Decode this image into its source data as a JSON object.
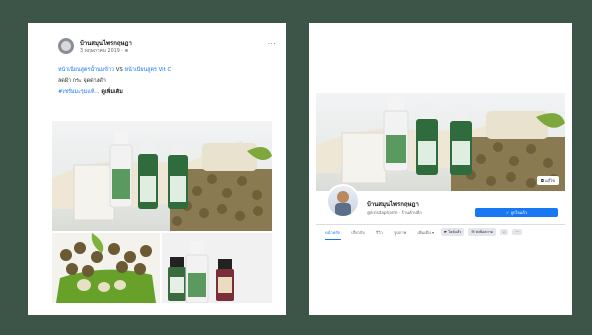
{
  "post": {
    "page_name": "บ้านสมุนไพรกฤษฎา",
    "date": "3 พฤษภาคม 2019 · ⊕",
    "more": "···",
    "line1_link_a": "หน้าเนียนสูตรน้ำนมข้าว",
    "line1_vs": " VS ",
    "line1_link_b": "หน้าเนียนสูตร Vit C",
    "line2": "ลดฝ้า กระ จุดด่างดำ",
    "line3_link": "#เซรั่มมะรุมแท้...",
    "line3_bold": " ดูเพิ่มเติม"
  },
  "page": {
    "name": "บ้านสมุนไพรกฤษฎา",
    "handle": "@krisdapharm · ร้านค้าปลีก",
    "like_button": "✓ ถูกใจแล้ว",
    "cover_button": "◘ แก้ไข",
    "tabs": [
      "หน้าหลัก",
      "เกี่ยวกับ",
      "รีวิว",
      "รูปภาพ",
      "เพิ่มเติม ▾"
    ],
    "actions": [
      "☛ ไลค์แล้ว",
      "✉ ส่งข้อความ",
      "⌕",
      "···"
    ]
  },
  "colors": {
    "background": "#3d5449",
    "link": "#1877f2",
    "text": "#1c1e21"
  }
}
